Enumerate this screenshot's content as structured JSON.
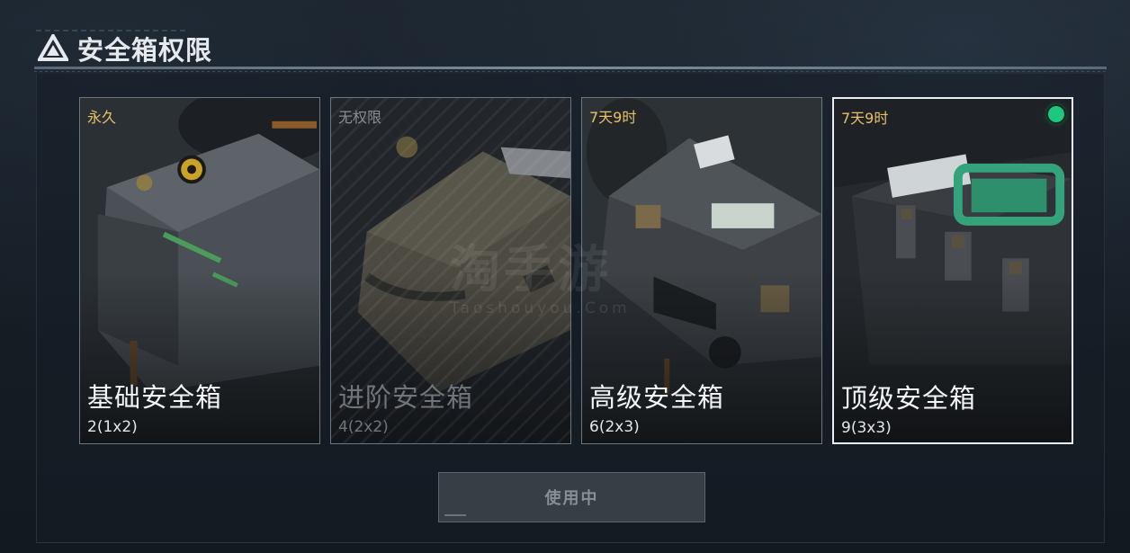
{
  "header": {
    "title": "安全箱权限",
    "logo_icon": "triangle-logo-icon"
  },
  "cards": [
    {
      "name": "基础安全箱",
      "capacity": "2(1x2)",
      "duration": "永久",
      "locked": false,
      "selected": false
    },
    {
      "name": "进阶安全箱",
      "capacity": "4(2x2)",
      "duration": "无权限",
      "locked": true,
      "selected": false
    },
    {
      "name": "高级安全箱",
      "capacity": "6(2x3)",
      "duration": "7天9时",
      "locked": false,
      "selected": false
    },
    {
      "name": "顶级安全箱",
      "capacity": "9(3x3)",
      "duration": "7天9时",
      "locked": false,
      "selected": true
    }
  ],
  "action_button": {
    "label": "使用中",
    "disabled": true
  },
  "watermark": {
    "text": "淘手游",
    "subtext": "Taoshouyou.Com"
  },
  "colors": {
    "duration": "#e8c066",
    "selected_indicator": "#1ec77f",
    "accent_teal": "#2fb58a"
  }
}
